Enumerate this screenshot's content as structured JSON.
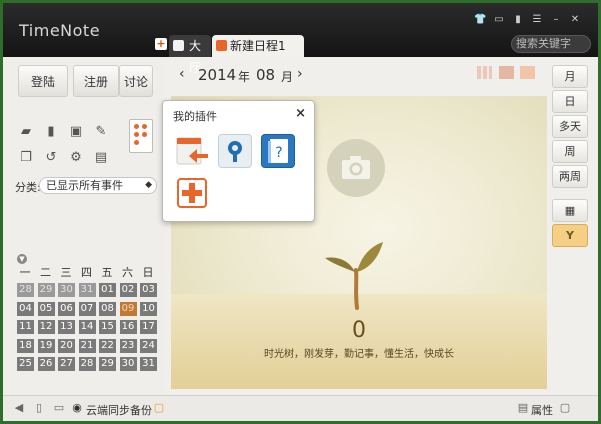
{
  "app": {
    "title": "TimeNote"
  },
  "search": {
    "placeholder": "搜索关键字"
  },
  "tabs": [
    {
      "label": "大厅"
    },
    {
      "label": "新建日程1"
    }
  ],
  "left": {
    "buttons": [
      "登陆",
      "注册",
      "讨论"
    ],
    "filter_label": "分类:",
    "filter_value": "已显示所有事件"
  },
  "month_nav": {
    "year": "2014",
    "year_unit": "年",
    "month": "08",
    "month_unit": "月",
    "prev": "‹",
    "next": "›"
  },
  "calendar": {
    "weekdays": [
      "一",
      "二",
      "三",
      "四",
      "五",
      "六",
      "日"
    ],
    "weeks": [
      [
        "28",
        "29",
        "30",
        "31",
        "01",
        "02",
        "03"
      ],
      [
        "04",
        "05",
        "06",
        "07",
        "08",
        "09",
        "10"
      ],
      [
        "11",
        "12",
        "13",
        "14",
        "15",
        "16",
        "17"
      ],
      [
        "18",
        "19",
        "20",
        "21",
        "22",
        "23",
        "24"
      ],
      [
        "25",
        "26",
        "27",
        "28",
        "29",
        "30",
        "31"
      ]
    ],
    "today": "09"
  },
  "main": {
    "count": "0",
    "slogan": "时光树，刚发芽，勤记事，懂生活，快成长"
  },
  "view_buttons": [
    "月",
    "日",
    "多天",
    "周",
    "两周"
  ],
  "popup": {
    "title": "我的插件",
    "close": "×"
  },
  "status": {
    "sync": "云端同步备份",
    "props": "属性"
  },
  "colors": {
    "accent": "#e8662a",
    "tab_active": "#f2f1ee",
    "titlebar": "#1c1c1c",
    "active_view": "#f5d084"
  }
}
